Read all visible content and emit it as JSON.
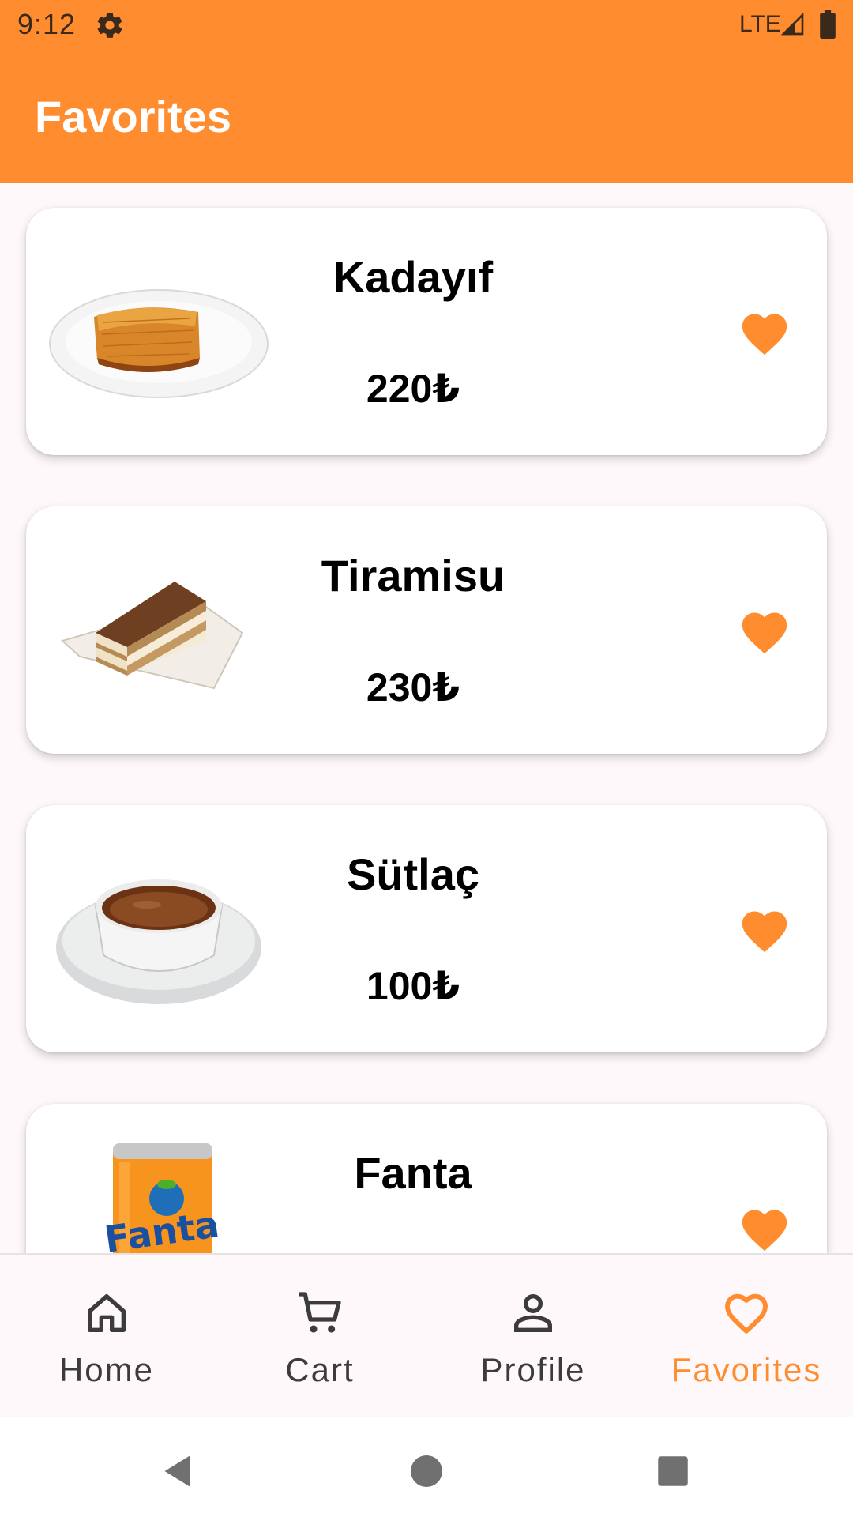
{
  "status_bar": {
    "time": "9:12",
    "network": "LTE",
    "icons": [
      "gear-icon",
      "signal-icon",
      "battery-icon"
    ]
  },
  "app_bar": {
    "title": "Favorites"
  },
  "favorites": [
    {
      "name": "Kadayıf",
      "price": "220₺",
      "image": "kadayif-image",
      "favorited": true
    },
    {
      "name": "Tiramisu",
      "price": "230₺",
      "image": "tiramisu-image",
      "favorited": true
    },
    {
      "name": "Sütlaç",
      "price": "100₺",
      "image": "sutlac-image",
      "favorited": true
    },
    {
      "name": "Fanta",
      "price": "",
      "image": "fanta-image",
      "favorited": true
    }
  ],
  "bottom_nav": {
    "items": [
      {
        "label": "Home",
        "icon": "home-icon",
        "active": false
      },
      {
        "label": "Cart",
        "icon": "cart-icon",
        "active": false
      },
      {
        "label": "Profile",
        "icon": "person-icon",
        "active": false
      },
      {
        "label": "Favorites",
        "icon": "heart-outline-icon",
        "active": true
      }
    ]
  },
  "system_nav": {
    "buttons": [
      "back-icon",
      "home-circle-icon",
      "recents-icon"
    ]
  },
  "colors": {
    "accent": "#ff8c2f",
    "background": "#fef8fb",
    "card": "#ffffff",
    "text": "#000000"
  }
}
